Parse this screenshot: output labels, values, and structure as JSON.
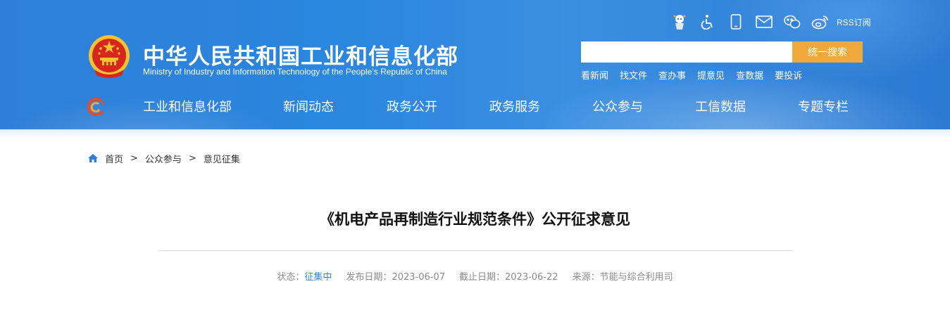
{
  "header": {
    "title": "中华人民共和国工业和信息化部",
    "subtitle": "Ministry of Industry and Information Technology of the People’s Republic of China",
    "toolbar": {
      "icons": [
        "robot-assistant-icon",
        "accessibility-icon",
        "mobile-icon",
        "mail-icon",
        "wechat-icon",
        "weibo-icon"
      ],
      "rss_label": "RSS订阅"
    },
    "search": {
      "placeholder": "",
      "button_label": "统一搜索"
    },
    "quick_links": [
      "看新闻",
      "找文件",
      "查办事",
      "提意见",
      "查数据",
      "要投诉"
    ],
    "nav": [
      "工业和信息化部",
      "新闻动态",
      "政务公开",
      "政务服务",
      "公众参与",
      "工信数据",
      "专题专栏"
    ]
  },
  "breadcrumb": {
    "items": [
      "首页",
      "公众参与",
      "意见征集"
    ],
    "separator": ">"
  },
  "article": {
    "title": "《机电产品再制造行业规范条件》公开征求意见",
    "meta": {
      "status_label": "状态：",
      "status_value": "征集中",
      "publish_label": "发布日期：",
      "publish_date": "2023-06-07",
      "deadline_label": "截止日期：",
      "deadline_date": "2023-06-22",
      "source_label": "来源：",
      "source_value": "节能与综合利用司"
    }
  },
  "colors": {
    "header_blue": "#2f7fd8",
    "search_button": "#f0a93a",
    "status_blue": "#3a82c8",
    "meta_gray": "#8a8a8a"
  }
}
